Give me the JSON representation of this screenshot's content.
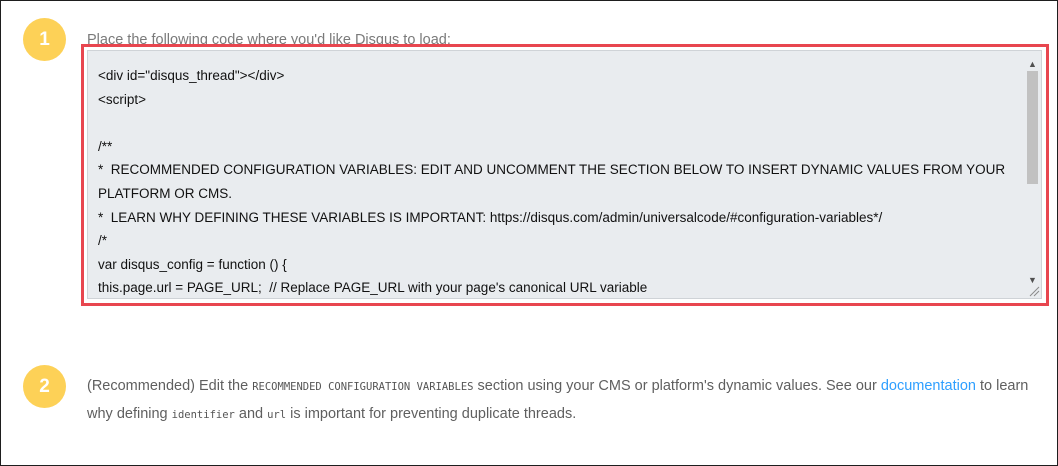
{
  "steps": [
    {
      "number": "1",
      "instruction": "Place the following code where you'd like Disqus to load:",
      "code": "<div id=\"disqus_thread\"></div>\n<script>\n\n/**\n*  RECOMMENDED CONFIGURATION VARIABLES: EDIT AND UNCOMMENT THE SECTION BELOW TO INSERT DYNAMIC VALUES FROM YOUR PLATFORM OR CMS.\n*  LEARN WHY DEFINING THESE VARIABLES IS IMPORTANT: https://disqus.com/admin/universalcode/#configuration-variables*/\n/*\nvar disqus_config = function () {\nthis.page.url = PAGE_URL;  // Replace PAGE_URL with your page's canonical URL variable\nthis.page.identifier = PAGE_IDENTIFIER; // Replace PAGE_IDENTIFIER with your page's unique identifier variable\n};\n*/"
    },
    {
      "number": "2",
      "text_before": "(Recommended) Edit the ",
      "code_section_name": "RECOMMENDED CONFIGURATION VARIABLES",
      "text_mid": " section using your CMS or platform's dynamic values. See our ",
      "link_label": "documentation",
      "text_after_link": " to learn why defining ",
      "code_identifier": "identifier",
      "text_and": " and ",
      "code_url": "url",
      "text_end": " is important for preventing duplicate threads."
    }
  ],
  "colors": {
    "badge": "#fdd157",
    "highlight_border": "#e8464f",
    "code_background": "#e9ecef",
    "link": "#2e9fff"
  },
  "icons": {
    "scroll_up": "scroll-up-arrow-icon",
    "scroll_down": "scroll-down-arrow-icon",
    "resize": "resize-grip-icon"
  }
}
